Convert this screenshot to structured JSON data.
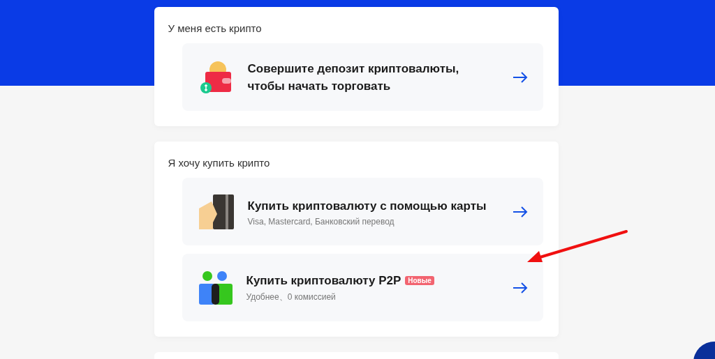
{
  "sections": [
    {
      "title": "У меня есть крипто",
      "options": [
        {
          "kind": "wallet",
          "title": "Совершите депозит криптовалюты, чтобы начать торговать"
        }
      ]
    },
    {
      "title": "Я хочу купить крипто",
      "options": [
        {
          "kind": "card",
          "title": "Купить криптовалюту с помощью карты",
          "subtitle": "Visa, Mastercard, Банковский перевод"
        },
        {
          "kind": "people",
          "title": "Купить криптовалюту P2P",
          "badge": "Новые",
          "subtitle": "Удобнее、0 комиссией"
        }
      ]
    }
  ]
}
